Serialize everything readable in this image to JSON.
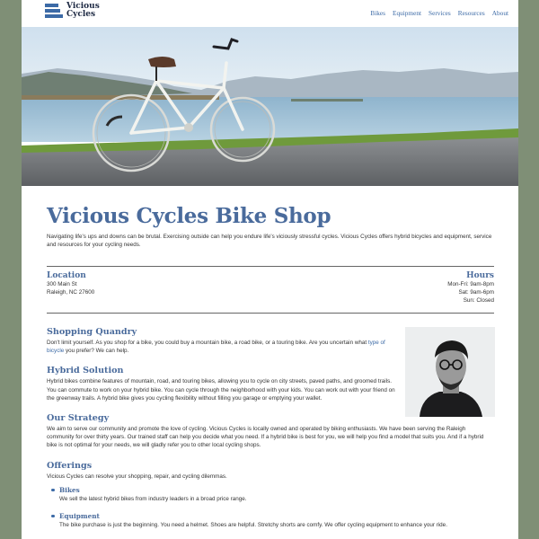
{
  "header": {
    "logo_line1": "Vicious",
    "logo_line2": "Cycles",
    "nav": [
      "Bikes",
      "Equipment",
      "Services",
      "Resources",
      "About"
    ]
  },
  "hero": {
    "icon": "bicycle-lake-photo"
  },
  "main": {
    "title": "Vicious Cycles Bike Shop",
    "intro": "Navigating life's ups and downs can be brutal. Exercising outside can help you endure life's viciously stressful cycles. Vicious Cycles offers hybrid bicycles and equipment, service and resources for your cycling needs.",
    "location": {
      "title": "Location",
      "line1": "300 Main St",
      "line2": "Raleigh, NC 27600"
    },
    "hours": {
      "title": "Hours",
      "line1": "Mon-Fri: 9am-8pm",
      "line2": "Sat: 9am-6pm",
      "line3": "Sun: Closed"
    },
    "sections": [
      {
        "title": "Shopping Quandry",
        "text_before": "Don't limit yourself. As you shop for a bike, you could buy a mountain bike, a road bike, or a touring bike. Are you uncertain what ",
        "link": "type of bicycle",
        "text_after": " you prefer? We can help."
      },
      {
        "title": "Hybrid Solution",
        "text": "Hybrid bikes combine features of mountain, road, and touring bikes, allowing you to cycle on city streets, paved paths, and groomed trails. You can commute to work on your hybrid bike. You can cycle through the neighborhood with your kids. You can work out with your friend on the greenway trails. A hybrid bike gives you cycling flexibility without filling you garage or emptying your wallet."
      },
      {
        "title": "Our Strategy",
        "text": "We aim to serve our community and promote the love of cycling. Vicious Cycles is locally owned and operated by biking enthusiasts. We have been serving the Raleigh community for over thirty years. Our trained staff can help you decide what you need. If a hybrid bike is best for you, we will help you find a model that suits you. And if a hybrid bike is not optimal for your needs, we will gladly refer you to other local cycling shops."
      },
      {
        "title": "Offerings",
        "text": "Vicious Cycles can resolve your shopping, repair, and cycling dilemmas."
      }
    ],
    "offerings": [
      {
        "title": "Bikes",
        "text": "We sell the latest hybrid bikes from industry leaders in a broad price range."
      },
      {
        "title": "Equipment",
        "text": "The bike purchase is just the beginning. You need a helmet. Shoes are helpful. Stretchy shorts are comfy. We offer cycling equipment to enhance your ride."
      }
    ],
    "portrait_icon": "staff-portrait-photo"
  }
}
